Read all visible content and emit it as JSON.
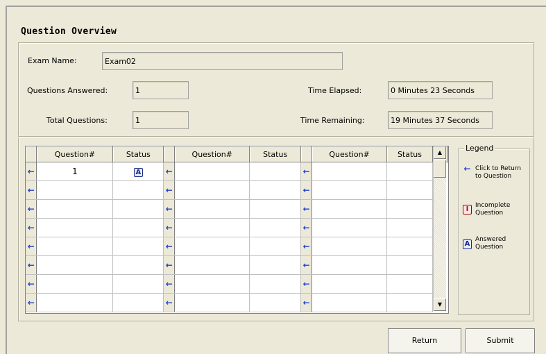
{
  "title": "Question Overview",
  "exam": {
    "name_label": "Exam Name:",
    "name_value": "Exam02"
  },
  "stats": {
    "answered_label": "Questions Answered:",
    "answered_value": "1",
    "total_label": "Total Questions:",
    "total_value": "1",
    "elapsed_label": "Time Elapsed:",
    "elapsed_value": "0 Minutes 23 Seconds",
    "remaining_label": "Time Remaining:",
    "remaining_value": "19 Minutes 37 Seconds"
  },
  "grid": {
    "headers": [
      "Question#",
      "Status",
      "Question#",
      "Status",
      "Question#",
      "Status"
    ],
    "rows": [
      [
        "1",
        "A",
        "",
        "",
        "",
        ""
      ],
      [
        "",
        "",
        "",
        "",
        "",
        ""
      ],
      [
        "",
        "",
        "",
        "",
        "",
        ""
      ],
      [
        "",
        "",
        "",
        "",
        "",
        ""
      ],
      [
        "",
        "",
        "",
        "",
        "",
        ""
      ],
      [
        "",
        "",
        "",
        "",
        "",
        ""
      ],
      [
        "",
        "",
        "",
        "",
        "",
        ""
      ],
      [
        "",
        "",
        "",
        "",
        "",
        ""
      ]
    ],
    "arrow_glyph": "←",
    "scroll_up_glyph": "▲",
    "scroll_down_glyph": "▼"
  },
  "legend": {
    "title": "Legend",
    "items": [
      {
        "icon": "arrow-left-icon",
        "glyph": "←",
        "text": "Click to Return to Question"
      },
      {
        "icon": "incomplete-icon",
        "glyph": "I",
        "text": "Incomplete Question"
      },
      {
        "icon": "answered-icon",
        "glyph": "A",
        "text": "Answered Question"
      }
    ]
  },
  "buttons": {
    "return": "Return",
    "submit": "Submit"
  },
  "colors": {
    "background": "#ECE9D8",
    "arrow": "#1E3FCF",
    "answered": "#1B2A80",
    "incomplete": "#C00000"
  }
}
